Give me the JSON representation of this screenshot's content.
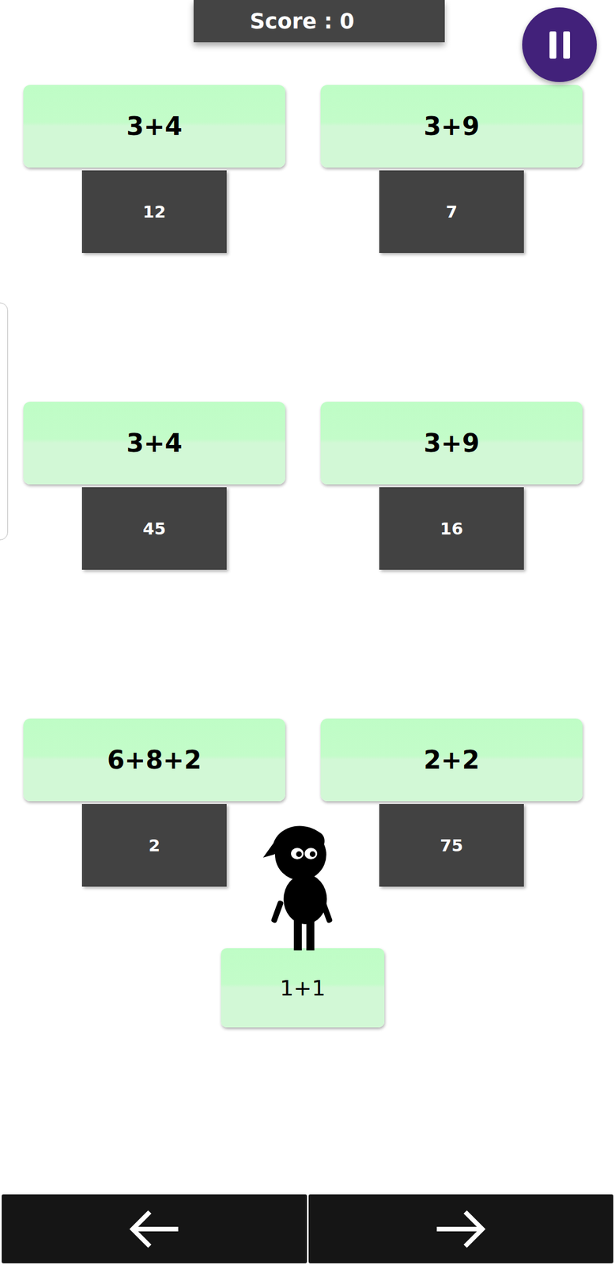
{
  "score": {
    "label": "Score : 0"
  },
  "rows": [
    {
      "platforms": [
        {
          "question": "3+4",
          "answer": "12"
        },
        {
          "question": "3+9",
          "answer": "7"
        }
      ]
    },
    {
      "platforms": [
        {
          "question": "3+4",
          "answer": "45"
        },
        {
          "question": "3+9",
          "answer": "16"
        }
      ]
    },
    {
      "platforms": [
        {
          "question": "6+8+2",
          "answer": "2"
        },
        {
          "question": "2+2",
          "answer": "75"
        }
      ]
    }
  ],
  "start_platform": {
    "question": "1+1"
  }
}
